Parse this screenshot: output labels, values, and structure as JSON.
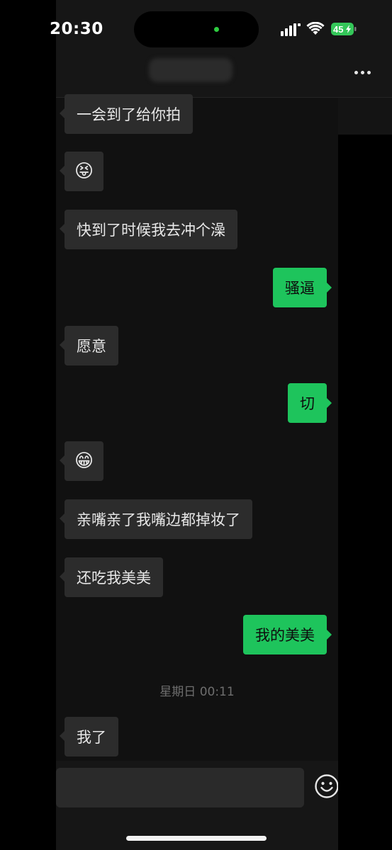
{
  "status_bar": {
    "time": "20:30",
    "battery": "45"
  },
  "header": {
    "contact_name": "",
    "more_icon": "more-dots-icon"
  },
  "messages": [
    {
      "side": "in",
      "text": "一会到了给你拍"
    },
    {
      "side": "in",
      "text": "😝"
    },
    {
      "side": "in",
      "text": "快到了时候我去冲个澡"
    },
    {
      "side": "out",
      "text": "骚逼"
    },
    {
      "side": "in",
      "text": "愿意"
    },
    {
      "side": "out",
      "text": "切"
    },
    {
      "side": "in",
      "text": "😁"
    },
    {
      "side": "in",
      "text": "亲嘴亲了我嘴边都掉妆了"
    },
    {
      "side": "in",
      "text": "还吃我美美"
    },
    {
      "side": "out",
      "text": "我的美美"
    },
    {
      "side": "in",
      "text": "我了"
    }
  ],
  "timestamp": "星期日 00:11",
  "input": {
    "value": "",
    "emoji_icon": "smiley-face-icon"
  },
  "colors": {
    "outgoing_bubble": "#1ec45c",
    "incoming_bubble": "#2c2c2c",
    "background": "#111111",
    "battery_fill": "#34c759"
  }
}
